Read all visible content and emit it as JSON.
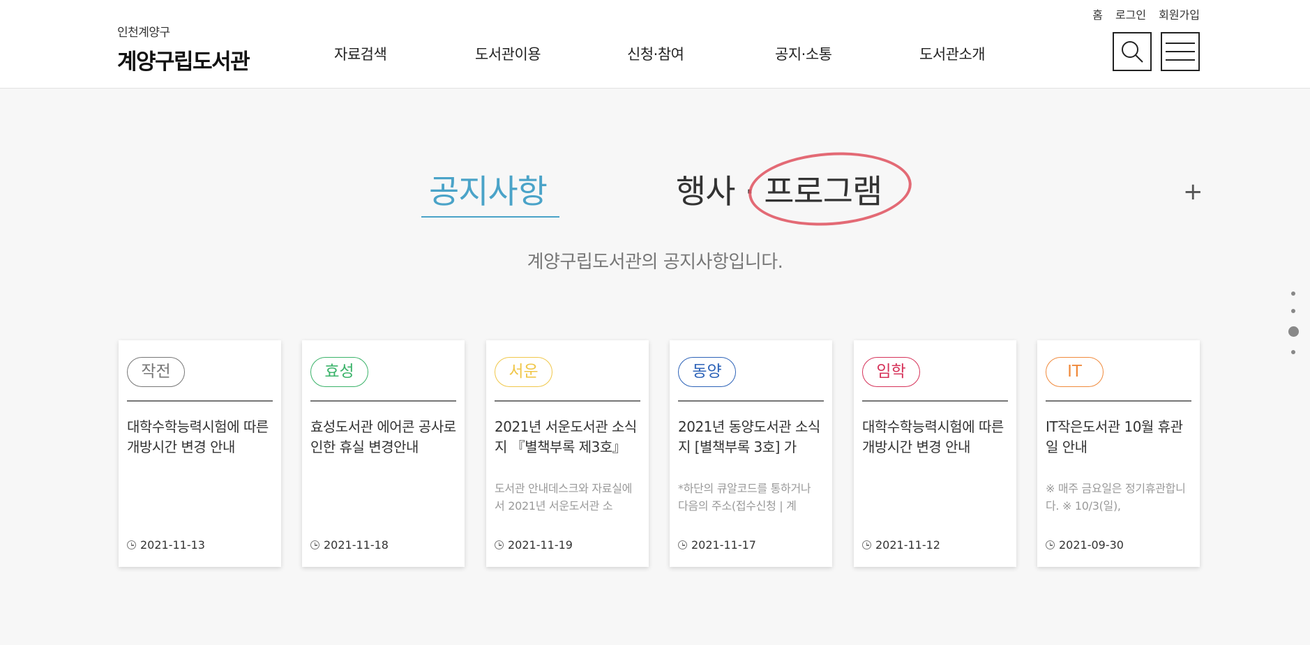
{
  "header": {
    "logo_sub": "인천계양구",
    "logo_main": "계양구립도서관",
    "util_links": [
      "홈",
      "로그인",
      "회원가입"
    ],
    "nav": [
      "자료검색",
      "도서관이용",
      "신청·참여",
      "공지·소통",
      "도서관소개"
    ],
    "search_icon": "search-icon",
    "menu_icon": "hamburger-menu-icon"
  },
  "main": {
    "tabs": [
      {
        "label": "공지사항",
        "active": true
      },
      {
        "label": "행사 · 프로그램",
        "active": false
      }
    ],
    "plus_label": "+",
    "subtitle": "계양구립도서관의 공지사항입니다.",
    "accent_color": "#4aa3c8",
    "annotation_color": "#e05a66"
  },
  "cards": [
    {
      "badge": "작전",
      "badge_color": "#777777",
      "title": "대학수학능력시험에 따른 개방시간 변경 안내",
      "desc": "",
      "date": "2021-11-13"
    },
    {
      "badge": "효성",
      "badge_color": "#3bb36a",
      "title": "효성도서관 에어콘 공사로 인한 휴실 변경안내",
      "desc": "",
      "date": "2021-11-18"
    },
    {
      "badge": "서운",
      "badge_color": "#f0c74a",
      "title": "2021년 서운도서관 소식지 『별책부록 제3호』",
      "desc": "도서관 안내데스크와 자료실에서 2021년 서운도서관 소",
      "date": "2021-11-19"
    },
    {
      "badge": "동양",
      "badge_color": "#2d63b8",
      "title": "2021년 동양도서관 소식지 [별책부록 3호] 가",
      "desc": "*하단의 큐알코드를 통하거나 다음의 주소(접수신청 | 계",
      "date": "2021-11-17"
    },
    {
      "badge": "임학",
      "badge_color": "#d6335a",
      "title": "대학수학능력시험에 따른 개방시간 변경 안내",
      "desc": "",
      "date": "2021-11-12"
    },
    {
      "badge": "IT",
      "badge_color": "#f08a3c",
      "title": "IT작은도서관 10월 휴관일 안내",
      "desc": "※ 매주 금요일은 정기휴관합니다. ※ 10/3(일),",
      "date": "2021-09-30"
    }
  ]
}
